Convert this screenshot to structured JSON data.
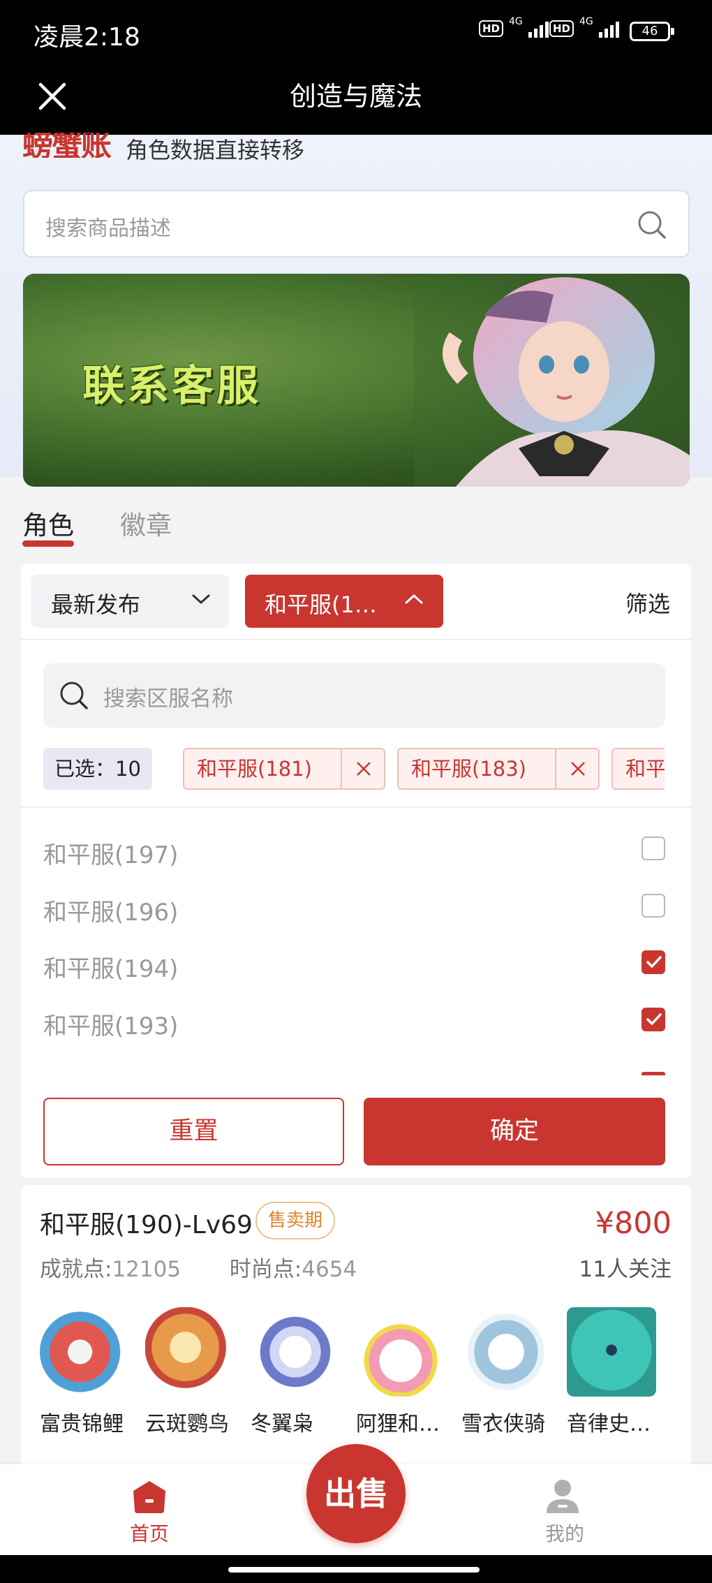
{
  "status_bar": {
    "time": "凌晨2:18",
    "net1": "4G",
    "net2": "4G",
    "battery": "46",
    "hd": "HD"
  },
  "title_bar": {
    "title": "创造与魔法"
  },
  "header": {
    "logo_text": "螃蟹账号",
    "slogan": "角色数据直接转移"
  },
  "search": {
    "placeholder": "搜索商品描述"
  },
  "banner": {
    "text": "联系客服"
  },
  "tabs": [
    {
      "label": "角色"
    },
    {
      "label": "徽章"
    }
  ],
  "filters": {
    "sort_label": "最新发布",
    "server_label": "和平服(1…",
    "filter_label": "筛选",
    "zone_search_placeholder": "搜索区服名称",
    "selected_count": "已选：10",
    "selected_chips": [
      {
        "label": "和平服(181)"
      },
      {
        "label": "和平服(183)"
      },
      {
        "label": "和平服"
      }
    ],
    "options": [
      {
        "label": "和平服(197)",
        "checked": false
      },
      {
        "label": "和平服(196)",
        "checked": false
      },
      {
        "label": "和平服(194)",
        "checked": true
      },
      {
        "label": "和平服(193)",
        "checked": true
      }
    ],
    "reset_label": "重置",
    "confirm_label": "确定"
  },
  "listing": {
    "title": "和平服(190)-Lv69",
    "badge": "售卖期",
    "price": "¥800",
    "achievement_label": "成就点:",
    "achievement_value": "12105",
    "fashion_label": "时尚点:",
    "fashion_value": "4654",
    "follows": "11人关注",
    "pets": [
      {
        "label": "富贵锦鲤",
        "icon": "koi-pet-icon",
        "color": "#e0584f"
      },
      {
        "label": "云斑鹦鸟",
        "icon": "parrot-pet-icon",
        "color": "#e79a4a"
      },
      {
        "label": "冬翼枭",
        "icon": "owl-pet-icon",
        "color": "#6f79c9"
      },
      {
        "label": "阿狸和…",
        "icon": "ali-pet-icon",
        "color": "#f29bb2"
      },
      {
        "label": "雪衣侠骑",
        "icon": "horse-pet-icon",
        "color": "#9fc5de"
      },
      {
        "label": "音律史…",
        "icon": "slime-pet-icon",
        "color": "#3fc5b8"
      }
    ]
  },
  "bottom_nav": {
    "home_label": "首页",
    "sell_label": "出售",
    "me_label": "我的"
  },
  "colors": {
    "accent": "#c8362f",
    "badge": "#e0862c"
  }
}
